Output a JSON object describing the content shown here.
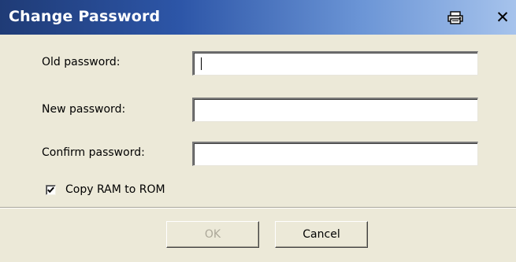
{
  "window": {
    "title": "Change Password",
    "titlebar_gradient": [
      "#1f3b76",
      "#a6c3ec"
    ],
    "background": "#ece9d8"
  },
  "titlebar_buttons": {
    "print_icon": "printer-icon",
    "close_label": "✕",
    "close_icon": "close-icon"
  },
  "form": {
    "old_password_label": "Old password:",
    "new_password_label": "New password:",
    "confirm_password_label": "Confirm password:",
    "old_password_value": "",
    "new_password_value": "",
    "confirm_password_value": "",
    "copy_ram_to_rom_label": "Copy RAM to ROM",
    "copy_ram_to_rom_checked": true
  },
  "buttons": {
    "ok_label": "OK",
    "ok_enabled": false,
    "cancel_label": "Cancel"
  }
}
